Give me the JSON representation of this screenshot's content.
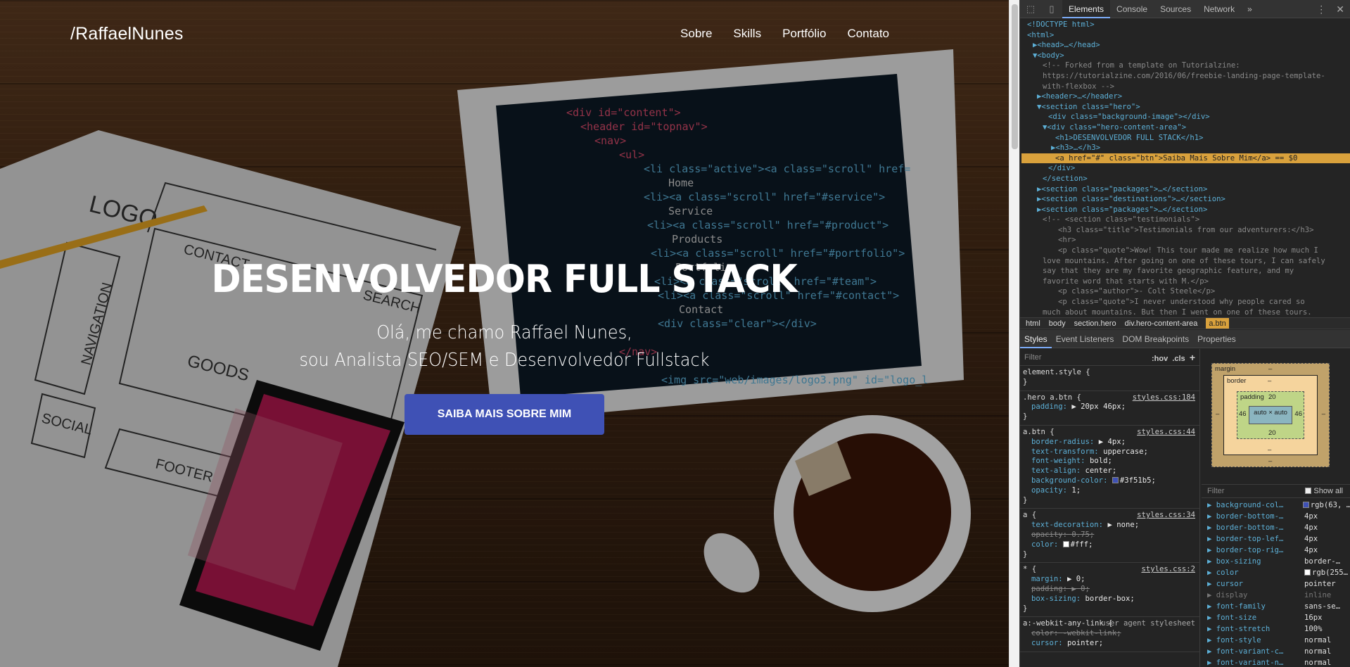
{
  "site": {
    "logo": "/RaffaelNunes",
    "nav": [
      "Sobre",
      "Skills",
      "Portfólio",
      "Contato"
    ],
    "hero": {
      "title": "DESENVOLVEDOR FULL STACK",
      "subtitle_line1": "Olá, me chamo Raffael Nunes,",
      "subtitle_line2": "sou Analista SEO/SEM e Desenvolvedor Fullstack",
      "button": "Saiba Mais Sobre Mim"
    }
  },
  "devtools": {
    "tabs": [
      "Elements",
      "Console",
      "Sources",
      "Network",
      "»"
    ],
    "dom": [
      "<!DOCTYPE html>",
      "<html>",
      "▶<head>…</head>",
      "▼<body>",
      "<!-- Forked from a template on Tutorialzine:",
      "https://tutorialzine.com/2016/06/freebie-landing-page-template-",
      "with-flexbox -->",
      "▶<header>…</header>",
      "▼<section class=\"hero\">",
      "<div class=\"background-image\"></div>",
      "▼<div class=\"hero-content-area\">",
      "<h1>DESENVOLVEDOR FULL STACK</h1>",
      "▶<h3>…</h3>",
      "<a href=\"#\" class=\"btn\">Saiba Mais Sobre Mim</a> == $0",
      "</div>",
      "</section>",
      "▶<section class=\"packages\">…</section>",
      "▶<section class=\"destinations\">…</section>",
      "▶<section class=\"packages\">…</section>",
      "<!-- <section class=\"testimonials\">",
      "<h3 class=\"title\">Testimonials from our adventurers:</h3>",
      "<hr>",
      "<p class=\"quote\">Wow! This tour made me realize how much I",
      "love mountains. After going on one of these tours, I can safely",
      "say that they are my favorite geographic feature, and my",
      "favorite word that starts with M.</p>",
      "<p class=\"author\">- Colt Steele</p>",
      "<p class=\"quote\">I never understood why people cared so",
      "much about mountains. But then I went on one of these tours."
    ],
    "breadcrumbs": [
      "html",
      "body",
      "section.hero",
      "div.hero-content-area",
      "a.btn"
    ],
    "panel_tabs": [
      "Styles",
      "Event Listeners",
      "DOM Breakpoints",
      "Properties"
    ],
    "styles": {
      "filter_placeholder": "Filter",
      "hov": ":hov",
      "cls": ".cls",
      "plus": "+",
      "element_style": "element.style {",
      "close": "}",
      "rules": [
        {
          "selector": ".hero a.btn {",
          "source": "styles.css:184",
          "props": [
            [
              "padding",
              "▶ 20px 46px;"
            ]
          ]
        },
        {
          "selector": "a.btn {",
          "source": "styles.css:44",
          "props": [
            [
              "border-radius",
              "▶ 4px;"
            ],
            [
              "text-transform",
              "uppercase;"
            ],
            [
              "font-weight",
              "bold;"
            ],
            [
              "text-align",
              "center;"
            ],
            [
              "background-color",
              "#3f51b5;"
            ],
            [
              "opacity",
              "1;"
            ]
          ]
        },
        {
          "selector": "a {",
          "source": "styles.css:34",
          "props": [
            [
              "text-decoration",
              "▶ none;"
            ],
            [
              "opacity",
              "0.75;"
            ],
            [
              "color",
              "#fff;"
            ]
          ]
        },
        {
          "selector": "* {",
          "source": "styles.css:2",
          "props": [
            [
              "margin",
              "▶ 0;"
            ],
            [
              "padding",
              "▶ 0;"
            ],
            [
              "box-sizing",
              "border-box;"
            ]
          ]
        }
      ],
      "ua_selector": "a:-webkit-any-link {",
      "ua_label": "user agent stylesheet",
      "ua_props": [
        [
          "color",
          "-webkit-link;"
        ],
        [
          "cursor",
          "pointer;"
        ]
      ]
    },
    "box_model": {
      "margin_label": "margin",
      "margin": "–",
      "border_label": "border",
      "border": "–",
      "padding_label": "padding",
      "padding_top": "20",
      "padding_bottom": "20",
      "padding_left": "46",
      "padding_right": "46",
      "content": "auto × auto",
      "margin_bottom": "–",
      "border_bottom": "–",
      "left_dash": "–",
      "right_dash": "–"
    },
    "computed": {
      "filter_placeholder": "Filter",
      "show_all": "Show all",
      "props": [
        [
          "background-col…",
          "rgb(63, …"
        ],
        [
          "border-bottom-…",
          "4px"
        ],
        [
          "border-bottom-…",
          "4px"
        ],
        [
          "border-top-lef…",
          "4px"
        ],
        [
          "border-top-rig…",
          "4px"
        ],
        [
          "box-sizing",
          "border-…"
        ],
        [
          "color",
          "rgb(255…"
        ],
        [
          "cursor",
          "pointer"
        ],
        [
          "display",
          "inline"
        ],
        [
          "font-family",
          "sans-se…"
        ],
        [
          "font-size",
          "16px"
        ],
        [
          "font-stretch",
          "100%"
        ],
        [
          "font-style",
          "normal"
        ],
        [
          "font-variant-c…",
          "normal"
        ],
        [
          "font-variant-n…",
          "normal"
        ]
      ]
    },
    "colors": {
      "accent": "#3f51b5",
      "selection": "#d9a13c"
    }
  }
}
